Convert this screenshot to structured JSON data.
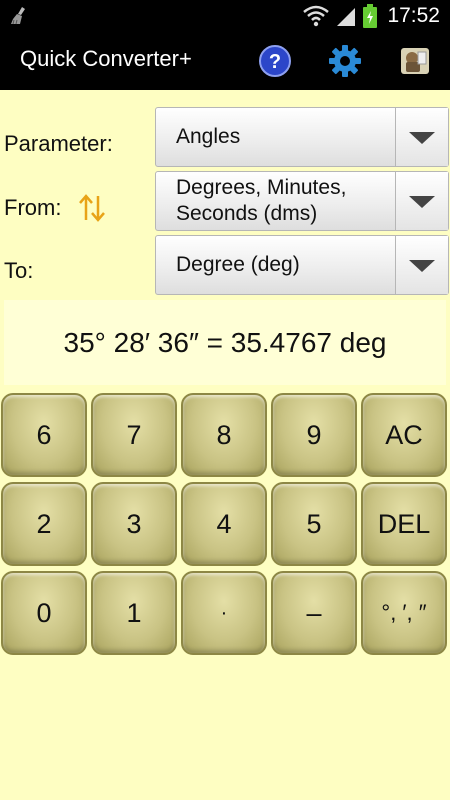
{
  "status_bar": {
    "time": "17:52"
  },
  "action_bar": {
    "title": "Quick Converter+"
  },
  "form": {
    "parameter_label": "Parameter:",
    "parameter_value": "Angles",
    "from_label": "From:",
    "from_value_line1": "Degrees, Minutes,",
    "from_value_line2": "Seconds (dms)",
    "to_label": "To:",
    "to_value": "Degree (deg)"
  },
  "result": {
    "text": "35° 28′ 36″ = 35.4767 deg"
  },
  "keypad": {
    "keys": [
      "6",
      "7",
      "8",
      "9",
      "AC",
      "2",
      "3",
      "4",
      "5",
      "DEL",
      "0",
      "1",
      "·",
      "–",
      "°, ′, ″"
    ]
  },
  "colors": {
    "background": "#fefec2",
    "result_bg": "#ffffd6",
    "key_face": "#c9c384",
    "accent_arrows": "#e8a317"
  },
  "icons": [
    "broom-icon",
    "wifi-icon",
    "signal-icon",
    "battery-icon",
    "help-icon",
    "settings-icon",
    "app-icon",
    "dropdown-icon",
    "swap-icon"
  ]
}
